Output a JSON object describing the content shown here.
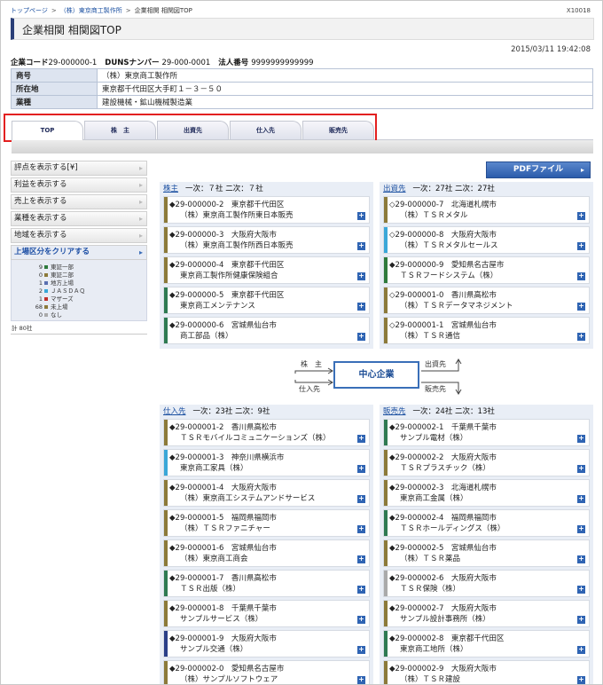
{
  "breadcrumb": {
    "home": "トップページ",
    "company": "（株）東京商工製作所",
    "current": "企業相関 相関図TOP"
  },
  "page_id": "X10018",
  "title": "企業相関 相関図TOP",
  "datetime": "2015/03/11 19:42:08",
  "codes": {
    "company_code_label": "企業コード",
    "company_code": "29-000000-1",
    "duns_label": "DUNSナンバー",
    "duns": "29-000-0001",
    "corp_no_label": "法人番号",
    "corp_no": "9999999999999"
  },
  "info": [
    {
      "label": "商号",
      "value": "（株）東京商工製作所"
    },
    {
      "label": "所在地",
      "value": "東京都千代田区大手町１－３－５０"
    },
    {
      "label": "業種",
      "value": "建設機械・鉱山機械製造業"
    }
  ],
  "tabs": [
    "TOP",
    "株　主",
    "出資先",
    "仕入先",
    "販売先"
  ],
  "side": {
    "buttons": [
      "評点を表示する[¥]",
      "利益を表示する",
      "売上を表示する",
      "業種を表示する",
      "地域を表示する"
    ],
    "clear_label": "上場区分をクリアする",
    "markets": [
      {
        "n": "9",
        "label": "東証一部",
        "color": "#2e7a3c"
      },
      {
        "n": "0",
        "label": "東証二部",
        "color": "#8c7a3a"
      },
      {
        "n": "1",
        "label": "地方上場",
        "color": "#5a6fb0"
      },
      {
        "n": "2",
        "label": "ＪＡＳＤＡＱ",
        "color": "#3aa7d8"
      },
      {
        "n": "1",
        "label": "マザーズ",
        "color": "#c0302b"
      },
      {
        "n": "68",
        "label": "未上場",
        "color": "#8c7a3a"
      },
      {
        "n": "0",
        "label": "なし",
        "color": "#aaaaaa"
      }
    ],
    "total": "計 80社"
  },
  "pdf_label": "PDFファイル",
  "panels": {
    "shareholders": {
      "link": "株主",
      "summary": "一次：７社 二次：７社",
      "items": [
        {
          "mark": "◆",
          "code": "29-000000-2",
          "loc": "東京都千代田区",
          "name": "（株）東京商工製作所東日本販売",
          "color": "#8c7a3a"
        },
        {
          "mark": "◆",
          "code": "29-000000-3",
          "loc": "大阪府大阪市",
          "name": "（株）東京商工製作所西日本販売",
          "color": "#8c7a3a"
        },
        {
          "mark": "◆",
          "code": "29-000000-4",
          "loc": "東京都千代田区",
          "name": "東京商工製作所健康保険組合",
          "color": "#8c7a3a"
        },
        {
          "mark": "◆",
          "code": "29-000000-5",
          "loc": "東京都千代田区",
          "name": "東京商工メンテナンス",
          "color": "#2e7a52"
        },
        {
          "mark": "◆",
          "code": "29-000000-6",
          "loc": "宮城県仙台市",
          "name": "商工部品（株）",
          "color": "#2e7a52"
        }
      ]
    },
    "investees": {
      "link": "出資先",
      "summary": "一次：27社 二次：27社",
      "items": [
        {
          "mark": "◇",
          "code": "29-000000-7",
          "loc": "北海道札幌市",
          "name": "（株）ＴＳＲメタル",
          "color": "#8c7a3a"
        },
        {
          "mark": "◇",
          "code": "29-000000-8",
          "loc": "大阪府大阪市",
          "name": "（株）ＴＳＲメタルセールス",
          "color": "#3aa7d8"
        },
        {
          "mark": "◆",
          "code": "29-000000-9",
          "loc": "愛知県名古屋市",
          "name": "ＴＳＲフードシステム（株）",
          "color": "#2e7a3c"
        },
        {
          "mark": "◇",
          "code": "29-000001-0",
          "loc": "香川県高松市",
          "name": "（株）ＴＳＲデータマネジメント",
          "color": "#8c7a3a"
        },
        {
          "mark": "◇",
          "code": "29-000001-1",
          "loc": "宮城県仙台市",
          "name": "（株）ＴＳＲ通信",
          "color": "#8c7a3a"
        }
      ]
    },
    "suppliers": {
      "link": "仕入先",
      "summary": "一次：23社 二次：9社",
      "items": [
        {
          "mark": "◆",
          "code": "29-000001-2",
          "loc": "香川県高松市",
          "name": "ＴＳＲモバイルコミュニケーションズ（株）",
          "color": "#8c7a3a"
        },
        {
          "mark": "◆",
          "code": "29-000001-3",
          "loc": "神奈川県横浜市",
          "name": "東京商工家具（株）",
          "color": "#3aa7d8"
        },
        {
          "mark": "◆",
          "code": "29-000001-4",
          "loc": "大阪府大阪市",
          "name": "（株）東京商工システムアンドサービス",
          "color": "#8c7a3a"
        },
        {
          "mark": "◆",
          "code": "29-000001-5",
          "loc": "福岡県福岡市",
          "name": "（株）ＴＳＲファニチャー",
          "color": "#8c7a3a"
        },
        {
          "mark": "◆",
          "code": "29-000001-6",
          "loc": "宮城県仙台市",
          "name": "（株）東京商工商会",
          "color": "#8c7a3a"
        },
        {
          "mark": "◆",
          "code": "29-000001-7",
          "loc": "香川県高松市",
          "name": "ＴＳＲ出版（株）",
          "color": "#2e7a52"
        },
        {
          "mark": "◆",
          "code": "29-000001-8",
          "loc": "千葉県千葉市",
          "name": "サンプルサービス（株）",
          "color": "#8c7a3a"
        },
        {
          "mark": "◆",
          "code": "29-000001-9",
          "loc": "大阪府大阪市",
          "name": "サンプル交通（株）",
          "color": "#2b3f88"
        },
        {
          "mark": "◆",
          "code": "29-000002-0",
          "loc": "愛知県名古屋市",
          "name": "（株）サンプルソフトウェア",
          "color": "#8c7a3a"
        }
      ]
    },
    "customers": {
      "link": "販売先",
      "summary": "一次：24社 二次：13社",
      "items": [
        {
          "mark": "◆",
          "code": "29-000002-1",
          "loc": "千葉県千葉市",
          "name": "サンプル電材（株）",
          "color": "#2e7a52"
        },
        {
          "mark": "◆",
          "code": "29-000002-2",
          "loc": "大阪府大阪市",
          "name": "ＴＳＲプラスチック（株）",
          "color": "#8c7a3a"
        },
        {
          "mark": "◆",
          "code": "29-000002-3",
          "loc": "北海道札幌市",
          "name": "東京商工金属（株）",
          "color": "#8c7a3a"
        },
        {
          "mark": "◆",
          "code": "29-000002-4",
          "loc": "福岡県福岡市",
          "name": "ＴＳＲホールディングス（株）",
          "color": "#2e7a52"
        },
        {
          "mark": "◆",
          "code": "29-000002-5",
          "loc": "宮城県仙台市",
          "name": "（株）ＴＳＲ薬品",
          "color": "#8c7a3a"
        },
        {
          "mark": "◆",
          "code": "29-000002-6",
          "loc": "大阪府大阪市",
          "name": "ＴＳＲ保険（株）",
          "color": "#aaaaaa"
        },
        {
          "mark": "◆",
          "code": "29-000002-7",
          "loc": "大阪府大阪市",
          "name": "サンプル設計事務所（株）",
          "color": "#8c7a3a"
        },
        {
          "mark": "◆",
          "code": "29-000002-8",
          "loc": "東京都千代田区",
          "name": "東京商工地所（株）",
          "color": "#2e7a52"
        },
        {
          "mark": "◆",
          "code": "29-000002-9",
          "loc": "大阪府大阪市",
          "name": "（株）ＴＳＲ建設",
          "color": "#8c7a3a"
        }
      ]
    }
  },
  "diagram": {
    "center": "中心企業",
    "shareholders": "株　主",
    "suppliers": "仕入先",
    "investees": "出資先",
    "customers": "販売先"
  }
}
